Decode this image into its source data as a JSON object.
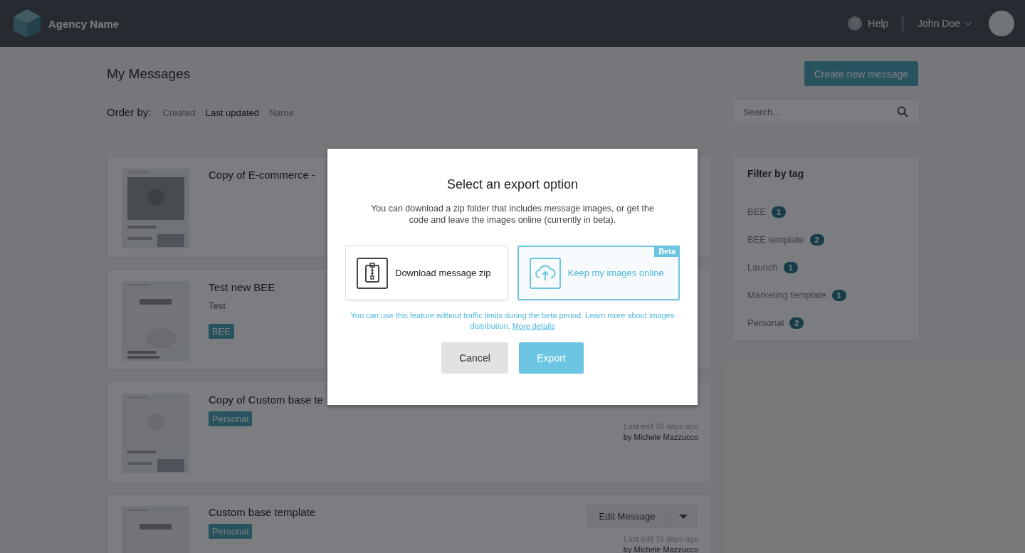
{
  "header": {
    "brand": "Agency Name",
    "help": "Help",
    "user": "John Doe"
  },
  "page": {
    "title": "My Messages",
    "create_button": "Create new message",
    "order_label": "Order by:",
    "order_options": [
      {
        "label": "Created",
        "selected": false
      },
      {
        "label": "Last updated",
        "selected": true
      },
      {
        "label": "Name",
        "selected": false
      }
    ],
    "search": {
      "placeholder": "Search..."
    }
  },
  "messages": [
    {
      "title": "Copy of E-commerce -"
    },
    {
      "title": "Test new BEE",
      "description": "Test",
      "tags": [
        "BEE"
      ]
    },
    {
      "title": "Copy of Custom base te",
      "tags": [
        "Personal"
      ],
      "meta": [
        "Last edit 16 days ago",
        "by Michele Mazzucco"
      ]
    },
    {
      "title": "Custom base template",
      "tags": [
        "Personal"
      ],
      "edit_button": "Edit Message",
      "meta": [
        "Last edit 16 days ago",
        "by Michele Mazzucco"
      ]
    }
  ],
  "tag_filter": {
    "title": "Filter by tag",
    "tags": [
      {
        "label": "BEE",
        "count": "1"
      },
      {
        "label": "BEE template",
        "count": "2"
      },
      {
        "label": "Launch",
        "count": "1"
      },
      {
        "label": "Marketing template",
        "count": "1"
      },
      {
        "label": "Personal",
        "count": "2"
      }
    ]
  },
  "modal": {
    "title": "Select an export option",
    "description": "You can download a zip folder that includes message images, or get the code and leave the images online (currently in beta).",
    "options": [
      {
        "kind": "zip",
        "label": "Download message zip",
        "selected": false
      },
      {
        "kind": "cloud",
        "label": "Keep my images online",
        "selected": true,
        "badge": "Beta"
      }
    ],
    "note": "You can use this feature without traffic limits during the beta period. Learn more about images distribution.",
    "link": "More details",
    "buttons": [
      {
        "kind": "secondary",
        "label": "Cancel"
      },
      {
        "kind": "primary",
        "label": "Export"
      }
    ]
  }
}
